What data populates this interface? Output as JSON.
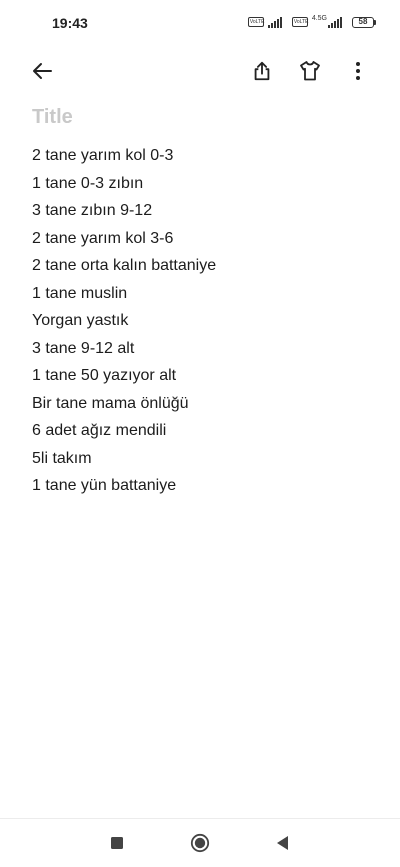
{
  "status_bar": {
    "time": "19:43",
    "sim1_badge": "VoLTE",
    "sim2_badge": "VoLTE",
    "sim2_network": "4.5G",
    "battery_level": "58"
  },
  "toolbar": {
    "back_icon": "arrow-left-icon",
    "share_icon": "share-icon",
    "theme_icon": "tshirt-icon",
    "more_icon": "more-vertical-icon"
  },
  "note": {
    "title_placeholder": "Title",
    "lines": [
      "2 tane yarım kol 0-3",
      "1 tane 0-3 zıbın",
      "3 tane zıbın 9-12",
      "2 tane yarım kol 3-6",
      "2 tane orta kalın battaniye",
      "1 tane muslin",
      "Yorgan yastık",
      "3 tane 9-12 alt",
      "1 tane 50 yazıyor alt",
      "Bir tane mama önlüğü",
      "6 adet ağız mendili",
      "5li takım",
      "1 tane yün battaniye"
    ]
  },
  "nav_bar": {
    "recents_icon": "square-icon",
    "home_icon": "circle-icon",
    "back_icon": "triangle-back-icon"
  },
  "colors": {
    "background": "#ffffff",
    "text": "#1c1c1c",
    "placeholder": "#c9c9c9",
    "icon": "#222222"
  }
}
